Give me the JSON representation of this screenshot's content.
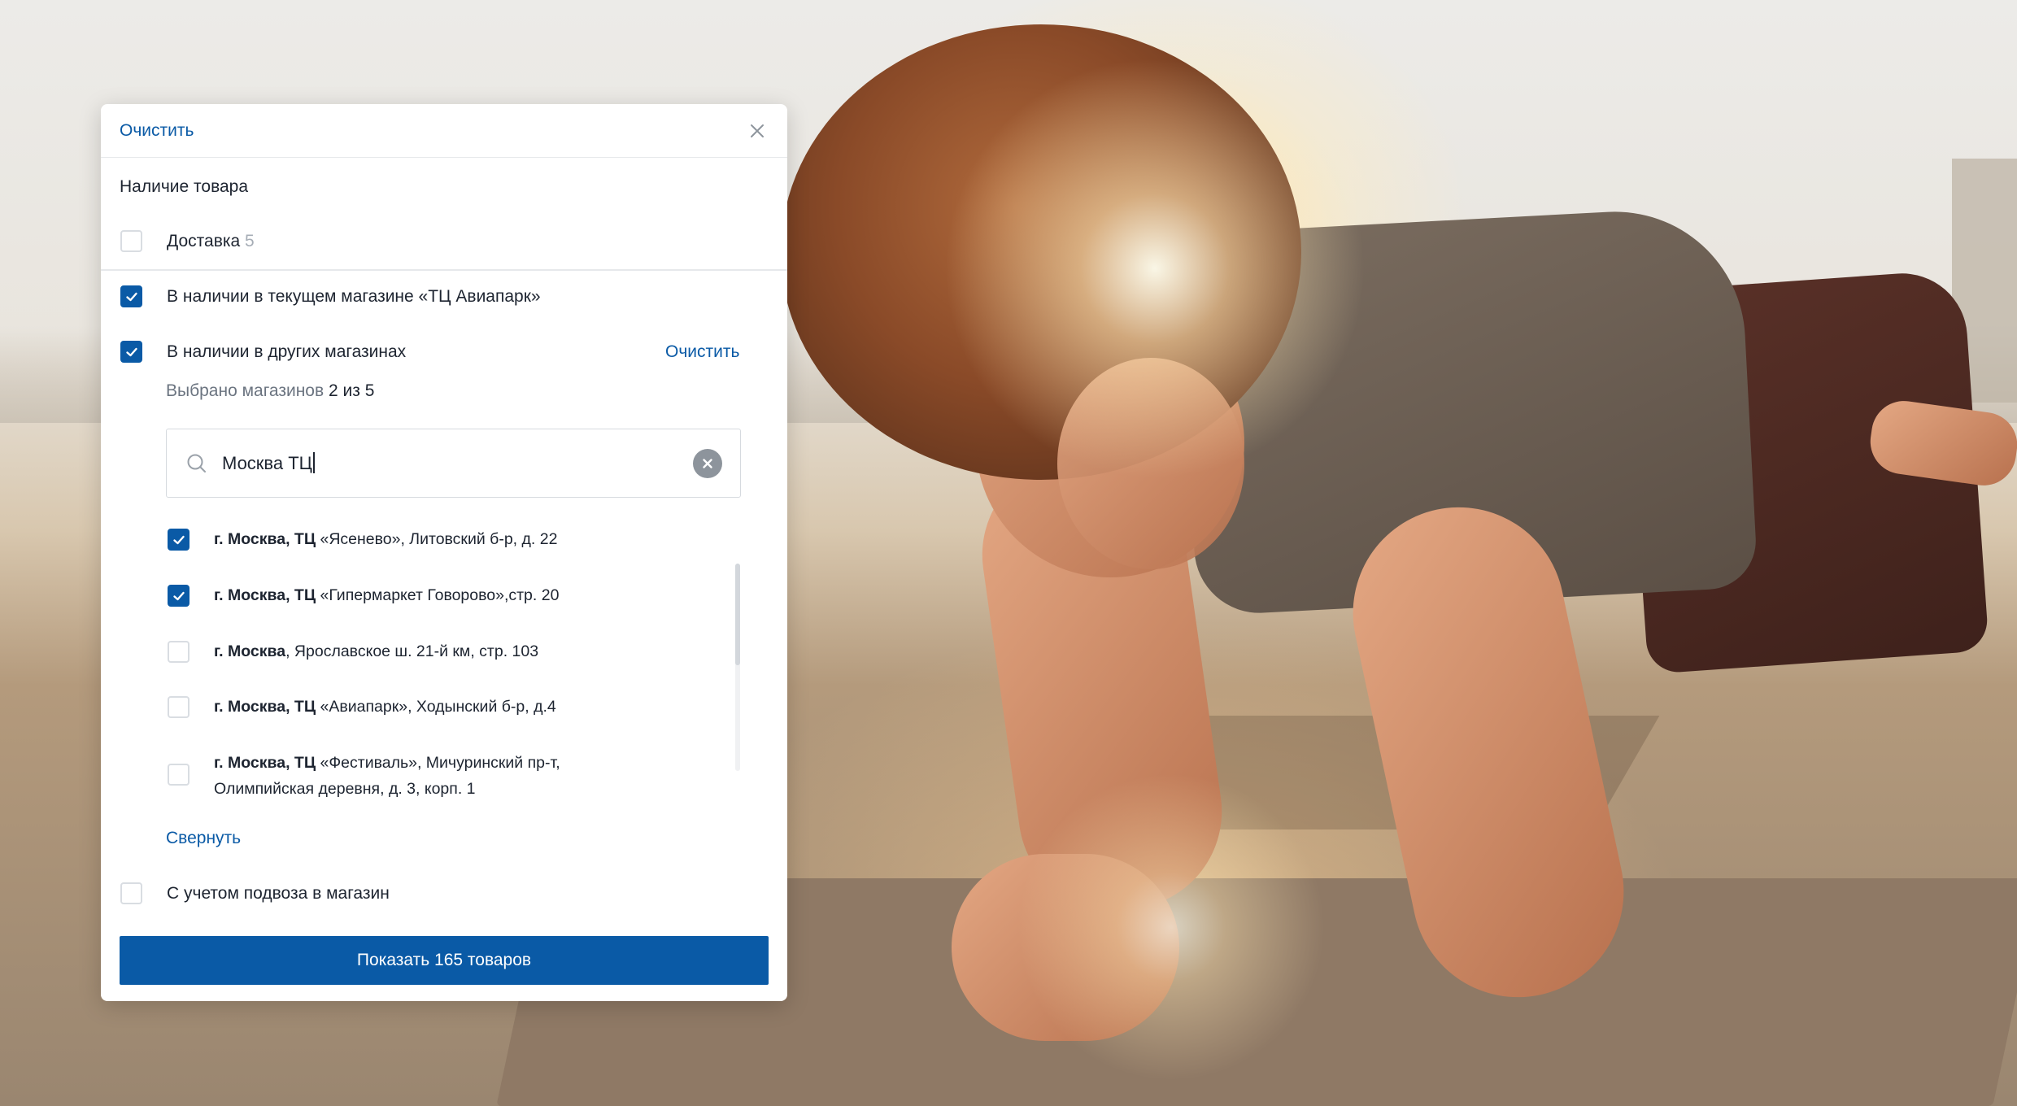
{
  "header": {
    "clear_label": "Очистить",
    "close_icon": "close-icon"
  },
  "section": {
    "title": "Наличие товара"
  },
  "options": {
    "delivery": {
      "label": "Доставка",
      "count": "5",
      "checked": false
    },
    "current_store": {
      "label": "В наличии в текущем магазине «ТЦ Авиапарк»",
      "checked": true
    },
    "other_stores": {
      "label": "В наличии в других магазинах",
      "checked": true,
      "clear_label": "Очистить"
    },
    "transfer": {
      "label": "С учетом подвоза в магазин",
      "checked": false
    }
  },
  "selected_info": {
    "prefix": "Выбрано магазинов",
    "value": "2 из 5"
  },
  "search": {
    "value": "Москва ТЦ",
    "icon": "search-icon",
    "clear_icon": "clear-icon"
  },
  "stores": [
    {
      "bold": "г. Москва, ТЦ",
      "rest": " «Ясенево», Литовский б-р, д. 22",
      "checked": true
    },
    {
      "bold": "г. Москва, ТЦ",
      "rest": " «Гипермаркет Говорово»,стр. 20",
      "checked": true
    },
    {
      "bold": "г. Москва",
      "rest": ", Ярославское ш. 21-й км, стр. 103",
      "checked": false
    },
    {
      "bold": "г. Москва, ТЦ",
      "rest": " «Авиапарк», Ходынский б-р, д.4",
      "checked": false
    },
    {
      "bold": "г. Москва, ТЦ",
      "rest": " «Фестиваль», Мичуринский пр-т,",
      "rest2": "Олимпийская деревня, д. 3, корп. 1",
      "checked": false
    }
  ],
  "collapse_label": "Свернуть",
  "submit_label": "Показать 165 товаров",
  "colors": {
    "accent": "#0a5aa6",
    "text": "#1d2430",
    "muted": "#a6adb6"
  }
}
